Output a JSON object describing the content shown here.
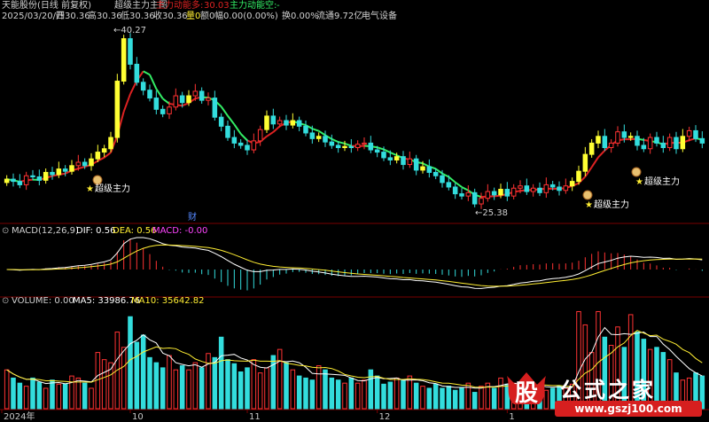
{
  "header": {
    "app_name": "天能股份(日线 前复权)",
    "indicator_title": "超级主力主图",
    "line1_label": "主力动能多:",
    "line1_value": "30.03",
    "line2_label": "主力动能空:",
    "line2_value": "-"
  },
  "ohlc_bar": {
    "date": "2025/03/20/四",
    "open": "开30.36",
    "high": "高30.36",
    "low": "低30.36",
    "close": "收30.36",
    "volume": "量0",
    "amount": "额0",
    "change": "幅0.00(0.00%)",
    "turnover": "换0.00%",
    "float_cap": "流通9.72亿",
    "sector": "电气设备"
  },
  "markers": {
    "high_label": "40.27",
    "low_label": "25.38",
    "signal_label": "超级主力",
    "news_label": "财"
  },
  "macd_panel": {
    "title": "MACD(12,26,9)",
    "dif": "DIF: 0.56",
    "dea": "DEA: 0.56",
    "macd": "MACD: -0.00"
  },
  "volume_panel": {
    "title": "VOLUME: 0.00",
    "ma5": "MA5: 33986.76",
    "ma10": "MA10: 35642.82"
  },
  "xaxis_labels": [
    "2024年",
    "10",
    "11",
    "12",
    "1"
  ],
  "colors": {
    "background": "#000000",
    "up": "#ff3333",
    "down": "#33dddd",
    "yellow_candle": "#ffff33",
    "ma_red": "#dd2222",
    "ma_green": "#33ee66",
    "dif": "#ffffff",
    "dea": "#ffee33",
    "text": "#c8c8c8",
    "grid": "#7a0000"
  },
  "watermark": {
    "logo_char": "股",
    "site_title": "公式之家",
    "site_url": "www.gszj100.com"
  },
  "chart_data": {
    "type": "candlestick",
    "price_range": [
      24.5,
      41.5
    ],
    "series": [
      {
        "name": "price",
        "values": [
          27.8,
          27.6,
          27.3,
          28.1,
          28.0,
          27.7,
          28.4,
          28.2,
          28.7,
          28.5,
          29.0,
          29.3,
          29.0,
          29.6,
          30.2,
          30.5,
          31.5,
          36.5,
          40.27,
          38.0,
          36.4,
          35.7,
          35.0,
          34.0,
          33.6,
          34.2,
          35.2,
          34.6,
          35.2,
          35.6,
          34.8,
          35.0,
          33.3,
          32.5,
          31.5,
          31.0,
          30.8,
          30.4,
          31.2,
          32.2,
          33.4,
          32.7,
          33.0,
          32.6,
          33.0,
          32.5,
          31.9,
          31.4,
          31.6,
          31.1,
          30.8,
          30.6,
          30.7,
          30.6,
          30.9,
          31.0,
          30.4,
          30.2,
          29.7,
          29.5,
          29.8,
          29.1,
          29.6,
          28.6,
          28.9,
          28.4,
          28.1,
          27.5,
          27.1,
          26.5,
          26.3,
          26.6,
          25.6,
          26.1,
          26.7,
          26.4,
          26.9,
          26.3,
          27.0,
          27.2,
          26.7,
          27.0,
          26.6,
          27.3,
          27.1,
          26.8,
          27.2,
          27.6,
          28.5,
          30.0,
          31.0,
          31.6,
          30.6,
          31.0,
          32.0,
          31.5,
          31.6,
          30.8,
          30.5,
          31.5,
          31.0,
          30.6,
          31.5,
          30.5,
          31.6,
          32.1,
          31.4,
          31.0
        ]
      },
      {
        "name": "volume",
        "values": [
          38,
          30,
          25,
          22,
          30,
          26,
          20,
          28,
          24,
          24,
          32,
          30,
          25,
          20,
          55,
          48,
          45,
          75,
          60,
          90,
          65,
          72,
          50,
          45,
          40,
          52,
          38,
          42,
          38,
          45,
          40,
          54,
          50,
          70,
          48,
          44,
          36,
          40,
          48,
          35,
          40,
          52,
          58,
          45,
          38,
          32,
          30,
          28,
          42,
          38,
          30,
          28,
          25,
          30,
          25,
          28,
          38,
          32,
          24,
          26,
          30,
          28,
          32,
          25,
          22,
          20,
          24,
          20,
          22,
          18,
          20,
          25,
          16,
          22,
          25,
          20,
          30,
          24,
          25,
          22,
          20,
          25,
          22,
          18,
          20,
          22,
          20,
          24,
          95,
          82,
          55,
          95,
          70,
          62,
          80,
          60,
          92,
          75,
          68,
          58,
          60,
          55,
          48,
          35,
          28,
          30,
          35,
          32
        ]
      }
    ]
  }
}
